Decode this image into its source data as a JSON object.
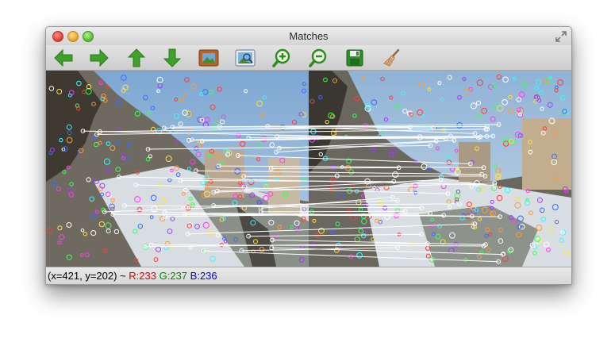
{
  "window": {
    "title": "Matches"
  },
  "toolbar": {
    "buttons": [
      {
        "name": "previous-button",
        "icon": "arrow-left-icon"
      },
      {
        "name": "next-button",
        "icon": "arrow-right-icon"
      },
      {
        "name": "up-button",
        "icon": "arrow-up-icon"
      },
      {
        "name": "down-button",
        "icon": "arrow-down-icon"
      },
      {
        "name": "fit-image-button",
        "icon": "picture-icon"
      },
      {
        "name": "zoom-region-button",
        "icon": "zoom-picture-icon"
      },
      {
        "name": "zoom-in-button",
        "icon": "zoom-in-icon"
      },
      {
        "name": "zoom-out-button",
        "icon": "zoom-out-icon"
      },
      {
        "name": "save-button",
        "icon": "save-icon"
      },
      {
        "name": "clear-button",
        "icon": "broom-icon"
      }
    ],
    "colors": {
      "arrow": "#3fa12a",
      "save": "#2d8f2a",
      "zoom": "#2f8a1f"
    }
  },
  "status": {
    "coords": "(x=421, y=202) ~",
    "r": "R:233",
    "g": "G:237",
    "b": "B:236"
  },
  "image": {
    "description_colors": {
      "sky": "#8fb3d6",
      "match_line": "#ffffff"
    }
  }
}
